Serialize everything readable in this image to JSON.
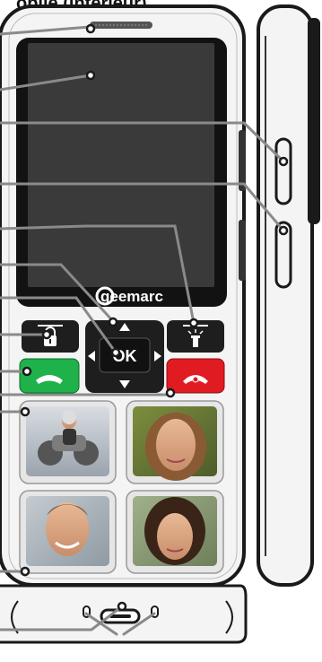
{
  "title": "obile (intérieur)",
  "brand": "geemarc",
  "keys": {
    "ok_label": "OK"
  },
  "icons": {
    "earpiece": "earpiece-grille-icon",
    "lock": "padlock-icon",
    "torch": "flashlight-icon",
    "call": "green-call-icon",
    "end_call": "red-end-call-icon",
    "up": "arrow-up-icon",
    "down": "arrow-down-icon",
    "left": "arrow-left-icon",
    "right": "arrow-right-icon",
    "usb": "usb-c-port-icon"
  },
  "photo_keys": [
    {
      "name": "photo-key-1",
      "subject": "motorcyclist"
    },
    {
      "name": "photo-key-2",
      "subject": "young-woman"
    },
    {
      "name": "photo-key-3",
      "subject": "smiling-man"
    },
    {
      "name": "photo-key-4",
      "subject": "woman-dark-hair"
    }
  ],
  "colors": {
    "body": "#f4f4f4",
    "outline": "#1a1a1a",
    "screen": "#3a3a3a",
    "call_green": "#1fb14a",
    "end_red": "#e11b22",
    "leader": "#8a8a8a"
  }
}
